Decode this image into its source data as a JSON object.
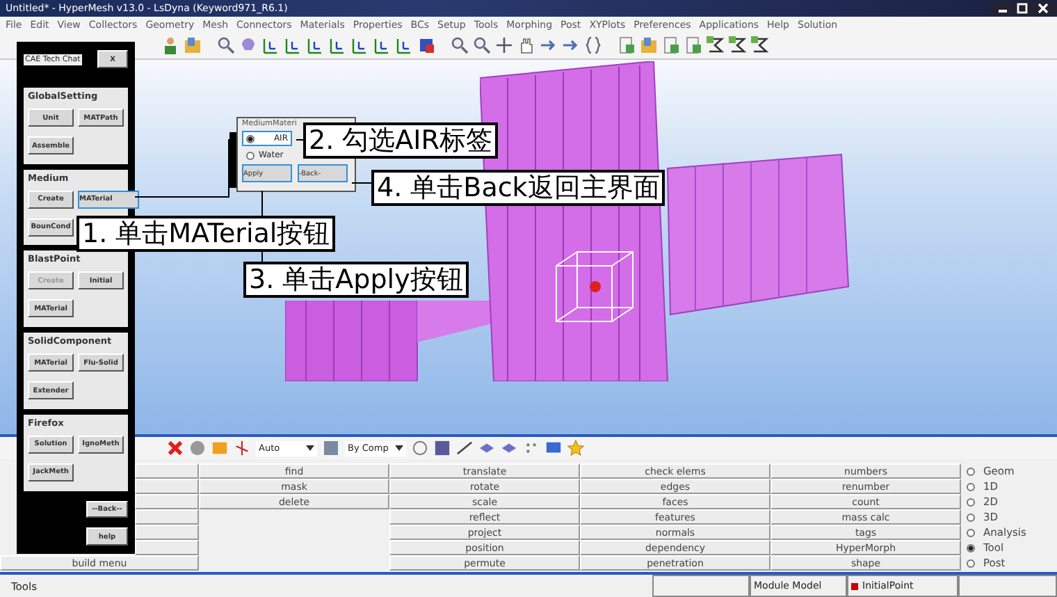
{
  "window": {
    "title": "Untitled* - HyperMesh v13.0 - LsDyna (Keyword971_R6.1)"
  },
  "menu": [
    "File",
    "Edit",
    "View",
    "Collectors",
    "Geometry",
    "Mesh",
    "Connectors",
    "Materials",
    "Properties",
    "BCs",
    "Setup",
    "Tools",
    "Morphing",
    "Post",
    "XYPlots",
    "Preferences",
    "Applications",
    "Help",
    "Solution"
  ],
  "toolbar_bottom": {
    "select_1": "Auto",
    "select_2": "By Comp"
  },
  "tool_panel": {
    "title": "CAE Tech Chat",
    "close": "X",
    "groups": [
      {
        "title": "GlobalSetting",
        "buttons": [
          {
            "label": "Unit",
            "disabled": false,
            "selected": false
          },
          {
            "label": "MATPath",
            "disabled": false,
            "selected": false
          },
          {
            "label": "Assemble",
            "disabled": false,
            "selected": false
          }
        ]
      },
      {
        "title": "Medium",
        "buttons": [
          {
            "label": "Create",
            "disabled": false,
            "selected": false
          },
          {
            "label": "MATerial",
            "disabled": false,
            "selected": true
          },
          {
            "label": "BounCond",
            "disabled": false,
            "selected": false
          }
        ]
      },
      {
        "title": "BlastPoint",
        "buttons": [
          {
            "label": "Create",
            "disabled": true,
            "selected": false
          },
          {
            "label": "Initial",
            "disabled": false,
            "selected": false
          },
          {
            "label": "MATerial",
            "disabled": false,
            "selected": false
          }
        ]
      },
      {
        "title": "SolidComponent",
        "buttons": [
          {
            "label": "MATerial",
            "disabled": false,
            "selected": false
          },
          {
            "label": "Flu-Solid",
            "disabled": false,
            "selected": false
          },
          {
            "label": "Extender",
            "disabled": false,
            "selected": false
          }
        ]
      },
      {
        "title": "Firefox",
        "buttons": [
          {
            "label": "Solution",
            "disabled": false,
            "selected": false
          },
          {
            "label": "IgnoMeth",
            "disabled": false,
            "selected": false
          },
          {
            "label": "JackMeth",
            "disabled": false,
            "selected": false
          }
        ]
      }
    ],
    "back": "--Back--",
    "help": "help"
  },
  "dialog": {
    "title": "MediumMateri",
    "options": [
      {
        "label": "AIR",
        "selected": true
      },
      {
        "label": "Water",
        "selected": false
      }
    ],
    "buttons": [
      {
        "label": "Apply",
        "selected": true
      },
      {
        "label": "-Back-",
        "selected": true
      }
    ]
  },
  "callouts": [
    "1. 单击MATerial按钮",
    "2. 勾选AIR标签",
    "3. 单击Apply按钮",
    "4. 单击Back返回主界面"
  ],
  "panel_grid": {
    "column_1": [
      "build menu"
    ],
    "columns": [
      [
        "find",
        "mask",
        "delete"
      ],
      [
        "translate",
        "rotate",
        "scale",
        "reflect",
        "project",
        "position",
        "permute"
      ],
      [
        "check elems",
        "edges",
        "faces",
        "features",
        "normals",
        "dependency",
        "penetration"
      ],
      [
        "numbers",
        "renumber",
        "count",
        "mass calc",
        "tags",
        "HyperMorph",
        "shape"
      ]
    ]
  },
  "radios": [
    {
      "label": "Geom",
      "selected": false
    },
    {
      "label": "1D",
      "selected": false
    },
    {
      "label": "2D",
      "selected": false
    },
    {
      "label": "3D",
      "selected": false
    },
    {
      "label": "Analysis",
      "selected": false
    },
    {
      "label": "Tool",
      "selected": true
    },
    {
      "label": "Post",
      "selected": false
    }
  ],
  "status_bar": {
    "mode": "Tools",
    "module": "Module Model",
    "component": "InitialPoint"
  }
}
